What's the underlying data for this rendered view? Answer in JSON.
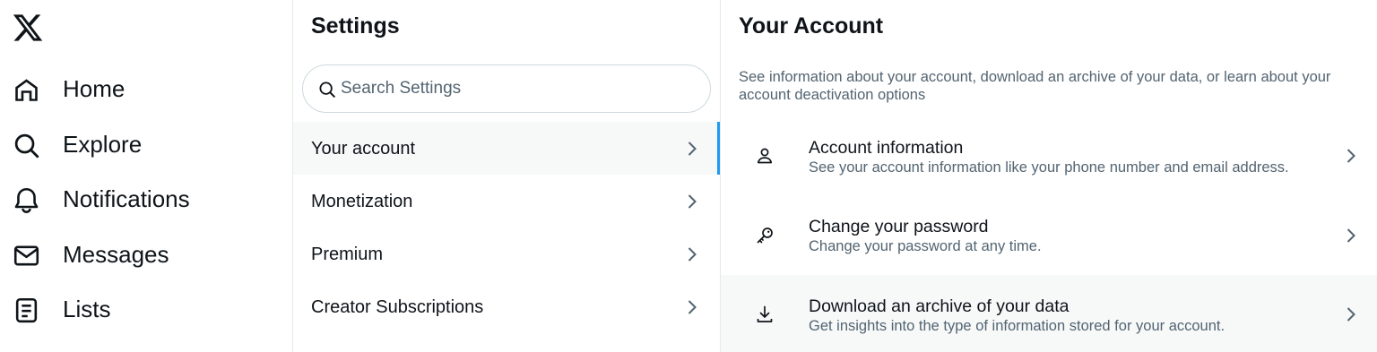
{
  "nav": {
    "logo_icon": "x-logo-icon",
    "items": [
      {
        "label": "Home",
        "icon": "home-icon"
      },
      {
        "label": "Explore",
        "icon": "search-icon"
      },
      {
        "label": "Notifications",
        "icon": "bell-icon"
      },
      {
        "label": "Messages",
        "icon": "envelope-icon"
      },
      {
        "label": "Lists",
        "icon": "list-icon"
      }
    ]
  },
  "settings": {
    "title": "Settings",
    "search_placeholder": "Search Settings",
    "items": [
      {
        "label": "Your account",
        "active": true
      },
      {
        "label": "Monetization",
        "active": false
      },
      {
        "label": "Premium",
        "active": false
      },
      {
        "label": "Creator Subscriptions",
        "active": false
      }
    ]
  },
  "account": {
    "title": "Your Account",
    "description": "See information about your account, download an archive of your data, or learn about your account deactivation options",
    "items": [
      {
        "title": "Account information",
        "subtitle": "See your account information like your phone number and email address.",
        "icon": "person-icon"
      },
      {
        "title": "Change your password",
        "subtitle": "Change your password at any time.",
        "icon": "key-icon"
      },
      {
        "title": "Download an archive of your data",
        "subtitle": "Get insights into the type of information stored for your account.",
        "icon": "download-icon"
      }
    ]
  },
  "colors": {
    "accent": "#1d9bf0",
    "text_primary": "#0f1419",
    "text_secondary": "#536471",
    "hover_bg": "#f7f9f9",
    "border": "#e7e9ea"
  }
}
